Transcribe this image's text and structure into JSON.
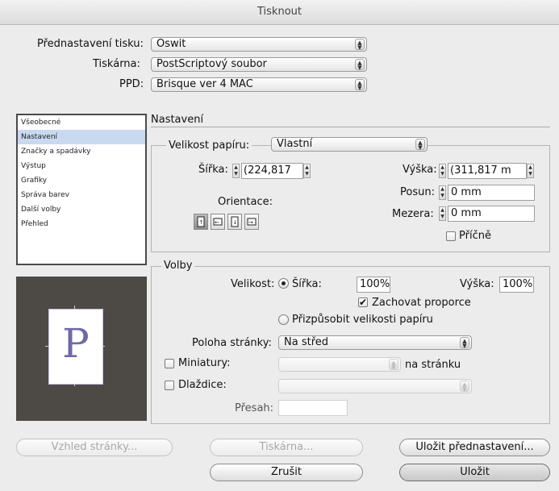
{
  "window": {
    "title": "Tisknout"
  },
  "top": {
    "preset_label": "Přednastavení tisku:",
    "preset_value": "Oswit",
    "printer_label": "Tiskárna:",
    "printer_value": "PostScriptový soubor",
    "ppd_label": "PPD:",
    "ppd_value": "Brisque ver 4 MAC"
  },
  "sidebar": {
    "items": [
      {
        "label": "Všeobecné"
      },
      {
        "label": "Nastavení",
        "selected": true
      },
      {
        "label": "Značky a spadávky"
      },
      {
        "label": "Výstup"
      },
      {
        "label": "Grafiky"
      },
      {
        "label": "Správa barev"
      },
      {
        "label": "Další volby"
      },
      {
        "label": "Přehled"
      }
    ]
  },
  "preview": {
    "letter": "P"
  },
  "settings": {
    "title": "Nastavení",
    "paper_size_label": "Velikost papíru:",
    "paper_size_value": "Vlastní",
    "width_label": "Šířka:",
    "width_value": "(224,817",
    "height_label": "Výška:",
    "height_value": "(311,817 m",
    "orientation_label": "Orientace:",
    "offset_label": "Posun:",
    "offset_value": "0 mm",
    "gap_label": "Mezera:",
    "gap_value": "0 mm",
    "transverse_label": "Příčně"
  },
  "options": {
    "title": "Volby",
    "size_label": "Velikost:",
    "width_radio_label": "Šířka:",
    "width_scale": "100%",
    "height_label": "Výška:",
    "height_scale": "100%",
    "keep_proportions_label": "Zachovat proporce",
    "fit_label": "Přizpůsobit velikosti papíru",
    "page_position_label": "Poloha stránky:",
    "page_position_value": "Na střed",
    "thumbnails_label": "Miniatury:",
    "per_page_label": "na stránku",
    "tiles_label": "Dlaždice:",
    "overlap_label": "Přesah:"
  },
  "buttons": {
    "page_setup": "Vzhled stránky...",
    "printer": "Tiskárna...",
    "save_preset": "Uložit přednastavení...",
    "cancel": "Zrušit",
    "save": "Uložit"
  }
}
